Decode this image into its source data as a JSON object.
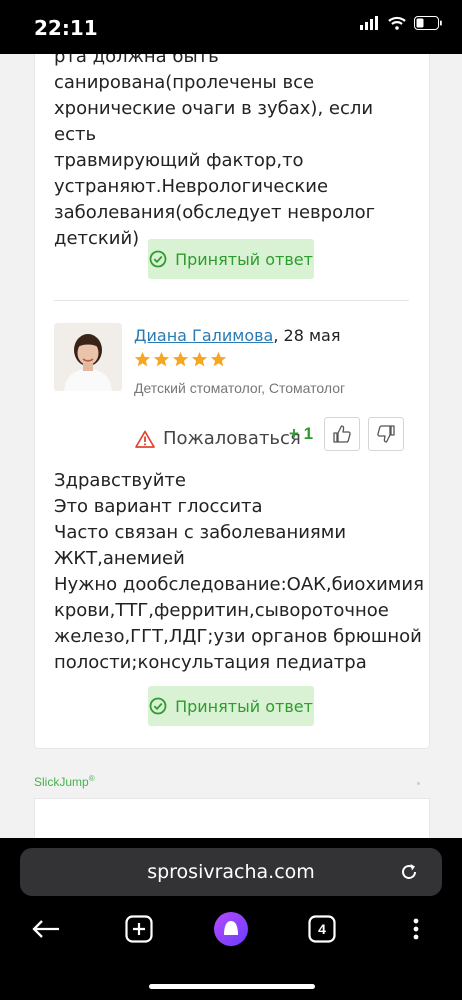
{
  "status": {
    "time": "22:11"
  },
  "first_answer": {
    "text_lines": [
      "рта должна быть",
      "санирована(пролечены все",
      "хронические очаги в зубах), если есть",
      "травмирующий фактор,то",
      "устраняют.Неврологические",
      "заболевания(обследует невролог",
      "детский)"
    ],
    "accepted_label": "Принятый ответ"
  },
  "answer": {
    "author_name": "Диана Галимова",
    "date": ", 28 мая",
    "rating_stars": 5,
    "specialty": "Детский стоматолог, Стоматолог",
    "complain_label": "Пожаловаться",
    "votes": "+ 1",
    "text_lines": [
      "Здравствуйте",
      "Это вариант глоссита",
      "Часто связан с заболеваниями",
      "ЖКТ,анемией",
      "Нужно дообследование:ОАК,биохимия",
      "крови,ТТГ,ферритин,сывороточное",
      "железо,ГГТ,ЛДГ;узи органов брюшной",
      "полости;консультация педиатра"
    ],
    "accepted_label": "Принятый ответ"
  },
  "ad": {
    "brand": "SlickJump",
    "mark": "®"
  },
  "browser": {
    "url": "sprosivracha.com",
    "tabs_count": "4"
  },
  "colors": {
    "accent_green": "#2e9c2e",
    "accepted_bg": "#d9f2d3",
    "link": "#2a7bb5",
    "star": "#f5a623"
  }
}
